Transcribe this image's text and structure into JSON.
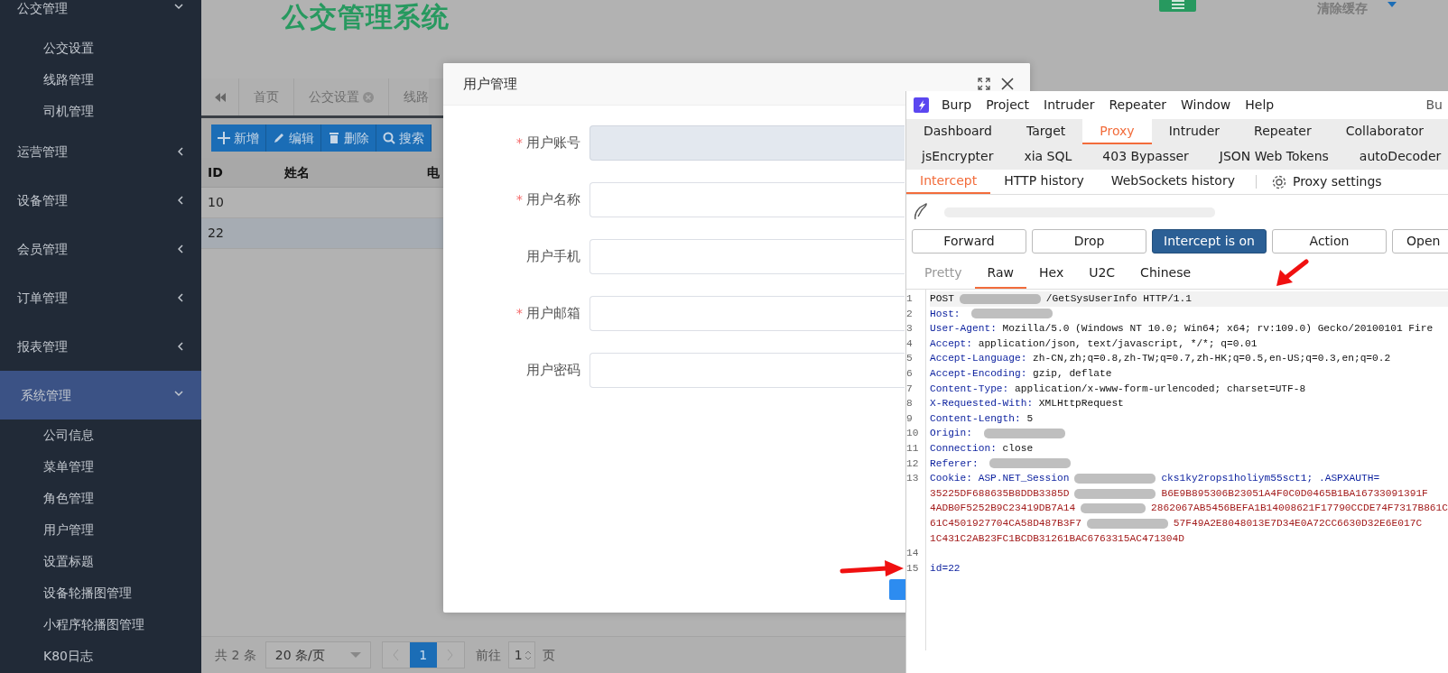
{
  "sidebar": {
    "items": [
      {
        "label": "公交管理",
        "expanded": true,
        "selected": false,
        "children": [
          {
            "label": "公交设置"
          },
          {
            "label": "线路管理"
          },
          {
            "label": "司机管理"
          }
        ]
      },
      {
        "label": "运营管理",
        "expanded": false,
        "selected": false
      },
      {
        "label": "设备管理",
        "expanded": false,
        "selected": false
      },
      {
        "label": "会员管理",
        "expanded": false,
        "selected": false
      },
      {
        "label": "订单管理",
        "expanded": false,
        "selected": false
      },
      {
        "label": "报表管理",
        "expanded": false,
        "selected": false
      },
      {
        "label": "系统管理",
        "expanded": true,
        "selected": true,
        "children": [
          {
            "label": "公司信息"
          },
          {
            "label": "菜单管理"
          },
          {
            "label": "角色管理"
          },
          {
            "label": "用户管理"
          },
          {
            "label": "设置标题"
          },
          {
            "label": "设备轮播图管理"
          },
          {
            "label": "小程序轮播图管理"
          },
          {
            "label": "K80日志"
          }
        ]
      }
    ]
  },
  "header": {
    "title": "公交管理系统",
    "clear_cache": "清除缓存"
  },
  "tabs": [
    {
      "label": "首页",
      "closable": false
    },
    {
      "label": "公交设置",
      "closable": true
    },
    {
      "label": "线路",
      "closable": false
    }
  ],
  "toolbar": [
    {
      "label": "新增"
    },
    {
      "label": "编辑"
    },
    {
      "label": "删除"
    },
    {
      "label": "搜索"
    }
  ],
  "table": {
    "columns": [
      "ID",
      "姓名",
      "电"
    ],
    "rows": [
      {
        "cells": [
          "10"
        ],
        "selected": false
      },
      {
        "cells": [
          "22"
        ],
        "selected": true
      }
    ]
  },
  "pagination": {
    "total": "共 2 条",
    "page_size": "20 条/页",
    "pages": [
      {
        "label": "1",
        "selected": true
      }
    ],
    "goto_label": "前往",
    "goto_value": "1",
    "page_unit": "页"
  },
  "dialog": {
    "title": "用户管理",
    "fields": [
      {
        "label": "用户账号",
        "required_mark": "*",
        "disabled": true
      },
      {
        "label": "用户名称",
        "required_mark": "*",
        "disabled": false
      },
      {
        "label": "用户手机",
        "disabled": false
      },
      {
        "label": "用户邮箱",
        "required_mark": "*",
        "disabled": false
      },
      {
        "label": "用户密码",
        "disabled": false
      }
    ]
  },
  "burp": {
    "menu": [
      "Burp",
      "Project",
      "Intruder",
      "Repeater",
      "Window",
      "Help"
    ],
    "title_fragment": "Bu",
    "tabs": [
      {
        "label": "Dashboard",
        "selected": false
      },
      {
        "label": "Target",
        "selected": false
      },
      {
        "label": "Proxy",
        "selected": true
      },
      {
        "label": "Intruder",
        "selected": false
      },
      {
        "label": "Repeater",
        "selected": false
      },
      {
        "label": "Collaborator",
        "selected": false
      }
    ],
    "extension_tabs": [
      "jsEncrypter",
      "xia SQL",
      "403 Bypasser",
      "JSON Web Tokens",
      "autoDecoder"
    ],
    "proxy_tabs": [
      {
        "label": "Intercept",
        "selected": true
      },
      {
        "label": "HTTP history",
        "selected": false
      },
      {
        "label": "WebSockets history",
        "selected": false
      }
    ],
    "proxy_settings": "Proxy settings",
    "buttons": [
      {
        "label": "Forward",
        "active": false
      },
      {
        "label": "Drop",
        "active": false
      },
      {
        "label": "Intercept is on",
        "active": true
      },
      {
        "label": "Action",
        "active": false
      },
      {
        "label": "Open",
        "active": false
      }
    ],
    "editor_tabs": [
      {
        "label": "Pretty",
        "selected": false,
        "disabled": true
      },
      {
        "label": "Raw",
        "selected": true,
        "disabled": false
      },
      {
        "label": "Hex",
        "selected": false,
        "disabled": false
      },
      {
        "label": "U2C",
        "selected": false,
        "disabled": false
      },
      {
        "label": "Chinese",
        "selected": false,
        "disabled": false
      }
    ],
    "lines": [
      {
        "number": "1",
        "parts": [
          {
            "kind": "plain",
            "text": "POST"
          },
          {
            "kind": "smudge"
          },
          {
            "kind": "plain",
            "text": "/GetSysUserInfo HTTP/1.1"
          }
        ]
      },
      {
        "number": "2",
        "parts": [
          {
            "kind": "name",
            "text": "Host:"
          },
          {
            "kind": "smudge"
          }
        ]
      },
      {
        "number": "3",
        "parts": [
          {
            "kind": "name",
            "text": "User-Agent:"
          },
          {
            "kind": "plain",
            "text": "Mozilla/5.0 (Windows NT 10.0; Win64; x64; rv:109.0) Gecko/20100101 Fire"
          }
        ]
      },
      {
        "number": "4",
        "parts": [
          {
            "kind": "name",
            "text": "Accept:"
          },
          {
            "kind": "plain",
            "text": "application/json, text/javascript, */*; q=0.01"
          }
        ]
      },
      {
        "number": "5",
        "parts": [
          {
            "kind": "name",
            "text": "Accept-Language:"
          },
          {
            "kind": "plain",
            "text": "zh-CN,zh;q=0.8,zh-TW;q=0.7,zh-HK;q=0.5,en-US;q=0.3,en;q=0.2"
          }
        ]
      },
      {
        "number": "6",
        "parts": [
          {
            "kind": "name",
            "text": "Accept-Encoding:"
          },
          {
            "kind": "plain",
            "text": "gzip, deflate"
          }
        ]
      },
      {
        "number": "7",
        "parts": [
          {
            "kind": "name",
            "text": "Content-Type:"
          },
          {
            "kind": "plain",
            "text": "application/x-www-form-urlencoded; charset=UTF-8"
          }
        ]
      },
      {
        "number": "8",
        "parts": [
          {
            "kind": "name",
            "text": "X-Requested-With:"
          },
          {
            "kind": "plain",
            "text": "XMLHttpRequest"
          }
        ]
      },
      {
        "number": "9",
        "parts": [
          {
            "kind": "name",
            "text": "Content-Length:"
          },
          {
            "kind": "plain",
            "text": "5"
          }
        ]
      },
      {
        "number": "10",
        "parts": [
          {
            "kind": "name",
            "text": "Origin:"
          },
          {
            "kind": "smudge"
          }
        ]
      },
      {
        "number": "11",
        "parts": [
          {
            "kind": "name",
            "text": "Connection:"
          },
          {
            "kind": "plain",
            "text": "close"
          }
        ]
      },
      {
        "number": "12",
        "parts": [
          {
            "kind": "name",
            "text": "Referer:"
          },
          {
            "kind": "smudge"
          }
        ]
      },
      {
        "number": "13",
        "parts": [
          {
            "kind": "name",
            "text": "Cookie:"
          },
          {
            "kind": "key",
            "text": "ASP.NET_Session"
          },
          {
            "kind": "smudge"
          },
          {
            "kind": "key",
            "text": "cks1ky2rops1holiym55sct1; .ASPXAUTH="
          }
        ]
      },
      {
        "parts": [
          {
            "kind": "cookie",
            "text": "35225DF688635B8DDB3385D"
          },
          {
            "kind": "smudge"
          },
          {
            "kind": "cookie",
            "text": "B6E9B895306B23051A4F0C0D0465B1BA16733091391F"
          }
        ]
      },
      {
        "parts": [
          {
            "kind": "cookie",
            "text": "4ADB0F5252B9C23419DB7A14"
          },
          {
            "kind": "smudge"
          },
          {
            "kind": "cookie",
            "text": "2862067AB5456BEFA1B14008621F17790CCDE74F7317B861C"
          }
        ]
      },
      {
        "parts": [
          {
            "kind": "cookie",
            "text": "61C4501927704CA58D487B3F7"
          },
          {
            "kind": "smudge"
          },
          {
            "kind": "cookie",
            "text": "57F49A2E8048013E7D34E0A72CC6630D32E6E017C"
          }
        ]
      },
      {
        "parts": [
          {
            "kind": "cookie",
            "text": "1C431C2AB23FC1BCDB31261BAC6763315AC471304D"
          }
        ]
      },
      {
        "number": "14"
      },
      {
        "number": "15",
        "parts": [
          {
            "kind": "key",
            "text": "id=22"
          }
        ]
      }
    ]
  }
}
